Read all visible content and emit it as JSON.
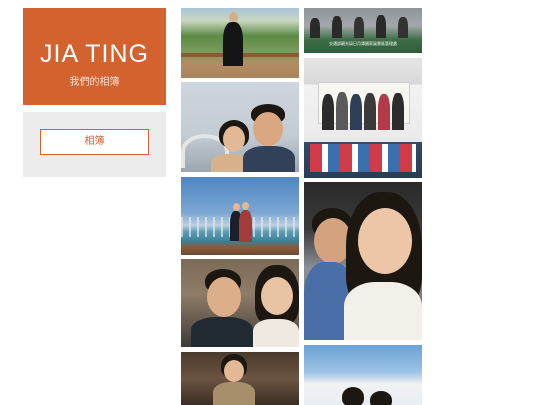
{
  "brand": {
    "title": "JIA TING",
    "subtitle": "我們的相簿"
  },
  "nav": {
    "album_button": "相簿"
  },
  "gallery": {
    "ceremony_banner": "交通部觀光局日月潭國家風景區管理處"
  }
}
